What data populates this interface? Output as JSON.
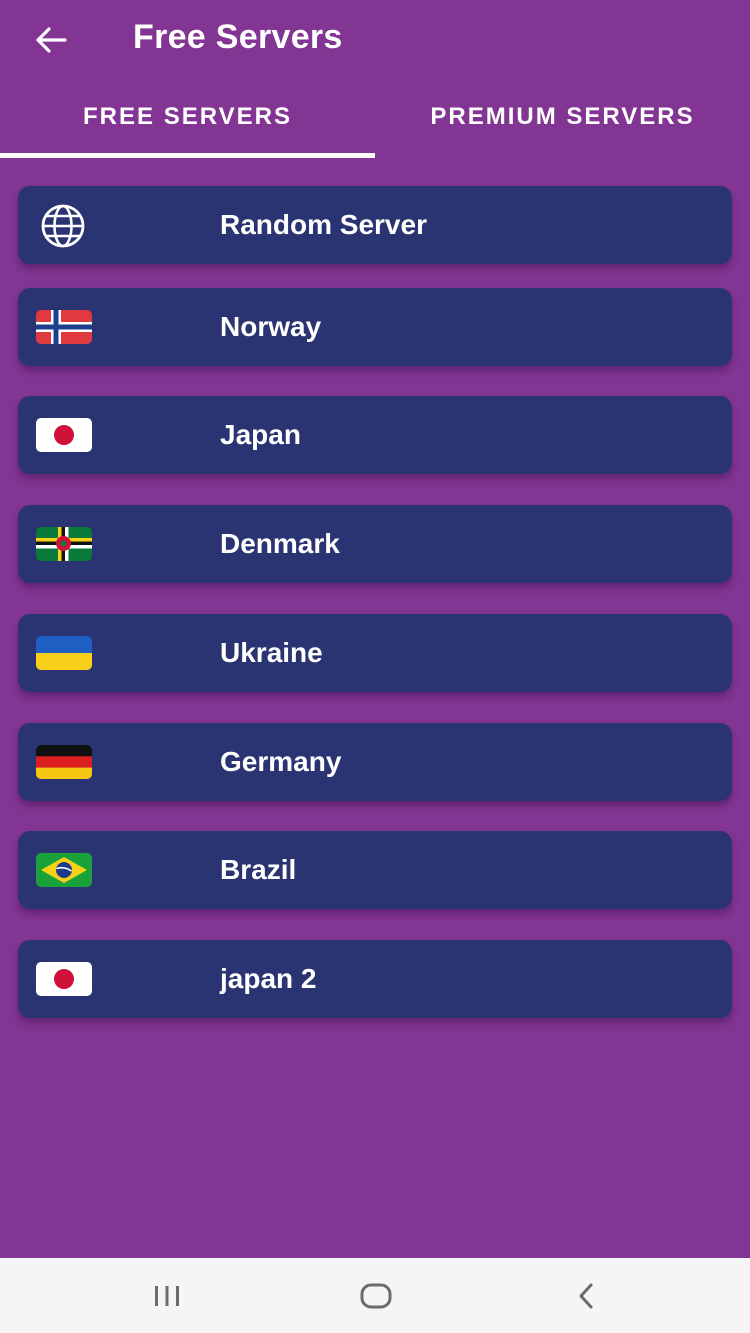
{
  "header": {
    "title": "Free Servers",
    "back_icon": "arrow-left-icon"
  },
  "tabs": [
    {
      "label": "FREE SERVERS",
      "active": true
    },
    {
      "label": "PREMIUM SERVERS",
      "active": false
    }
  ],
  "servers": [
    {
      "name": "Random Server",
      "icon": "globe-icon"
    },
    {
      "name": "Norway",
      "icon": "flag-norway-icon"
    },
    {
      "name": "Japan",
      "icon": "flag-japan-icon"
    },
    {
      "name": "Denmark",
      "icon": "flag-dominica-icon"
    },
    {
      "name": "Ukraine",
      "icon": "flag-ukraine-icon"
    },
    {
      "name": "Germany",
      "icon": "flag-germany-icon"
    },
    {
      "name": "Brazil",
      "icon": "flag-brazil-icon"
    },
    {
      "name": "japan 2",
      "icon": "flag-japan-icon"
    }
  ],
  "system_nav": {
    "recents_icon": "recent-apps-icon",
    "home_icon": "home-icon",
    "back_icon": "back-chevron-icon"
  },
  "colors": {
    "background": "#823592",
    "card": "#2b3472",
    "nav_bar": "#f5f5f7"
  }
}
